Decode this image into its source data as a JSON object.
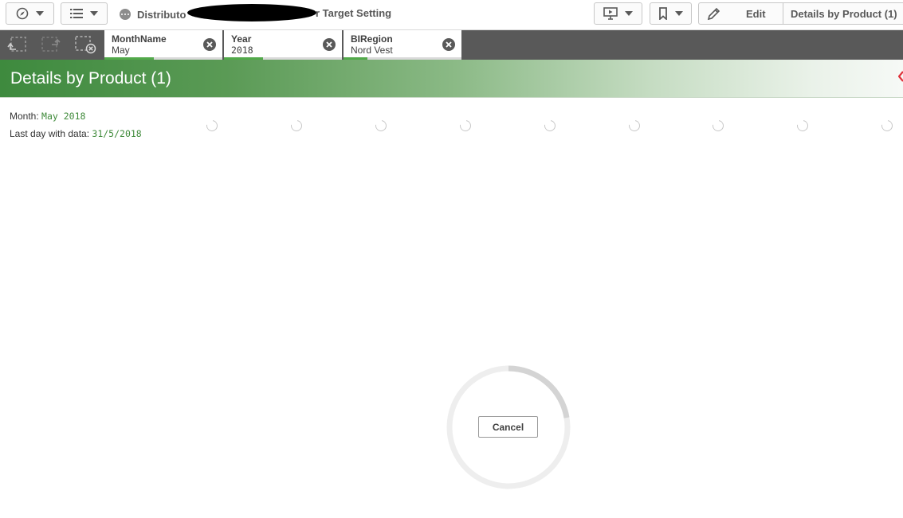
{
  "toolbar": {
    "navigation_icon": "compass-icon",
    "list_icon": "list-icon",
    "app_title_start": "Distributo",
    "app_title_end": "r Target Setting",
    "present_icon": "presentation-icon",
    "bookmark_icon": "bookmark-icon",
    "edit_label": "Edit",
    "sheet_label": "Details by Product (1)"
  },
  "selections": {
    "tools": [
      "step-back-icon",
      "step-forward-icon",
      "clear-all-selections-icon"
    ],
    "chips": [
      {
        "field": "MonthName",
        "value": "May",
        "selected_fraction": 0.42
      },
      {
        "field": "Year",
        "value": "2018",
        "selected_fraction": 0.33
      },
      {
        "field": "BIRegion",
        "value": "Nord Vest",
        "selected_fraction": 0.2
      }
    ]
  },
  "sheet": {
    "title": "Details by Product (1)"
  },
  "content": {
    "month_label": "Month:",
    "month_value": "May 2018",
    "lastday_label": "Last day with data:",
    "lastday_value": "31/5/2018"
  },
  "loading": {
    "cancel_label": "Cancel"
  },
  "colors": {
    "accent_green": "#52a94a",
    "header_green": "#3e8a3e",
    "selection_bar": "#595959"
  }
}
